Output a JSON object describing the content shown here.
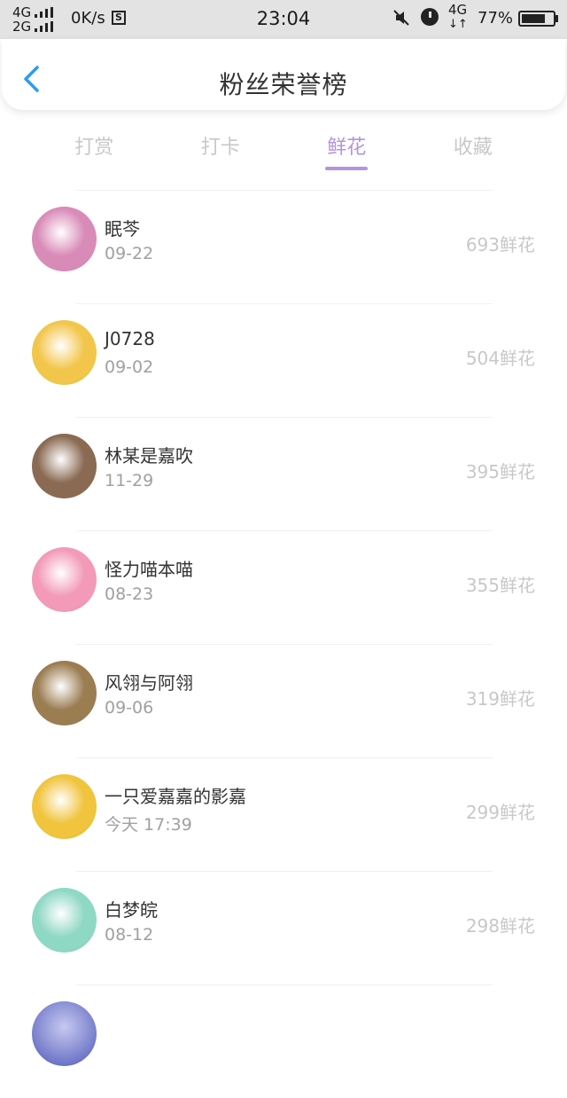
{
  "status_bar": {
    "net1": "4G",
    "net2": "2G",
    "speed": "0K/s",
    "s_icon": "S",
    "time": "23:04",
    "net_right": "4G",
    "battery": "77%",
    "battery_level": 0.77
  },
  "header": {
    "title": "粉丝荣誉榜",
    "back_icon": "chevron-left-icon"
  },
  "tabs": [
    {
      "label": "打赏",
      "active": false
    },
    {
      "label": "打卡",
      "active": false
    },
    {
      "label": "鲜花",
      "active": true
    },
    {
      "label": "收藏",
      "active": false
    }
  ],
  "fans": [
    {
      "name": "眠芩",
      "date": "09-22",
      "count": "693鲜花",
      "avatar_color": "#d98bb8"
    },
    {
      "name": "J0728",
      "date": "09-02",
      "count": "504鲜花",
      "avatar_color": "#f2c64a"
    },
    {
      "name": "林某是嘉吹",
      "date": "11-29",
      "count": "395鲜花",
      "avatar_color": "#8a6a52"
    },
    {
      "name": "怪力喵本喵",
      "date": "08-23",
      "count": "355鲜花",
      "avatar_color": "#f29ab8"
    },
    {
      "name": "风翎与阿翎",
      "date": "09-06",
      "count": "319鲜花",
      "avatar_color": "#9b7d52"
    },
    {
      "name": "一只爱嘉嘉的影嘉",
      "date": "今天 17:39",
      "count": "299鲜花",
      "avatar_color": "#f0c43c"
    },
    {
      "name": "白梦皖",
      "date": "08-12",
      "count": "298鲜花",
      "avatar_color": "#8fd8c4"
    }
  ]
}
